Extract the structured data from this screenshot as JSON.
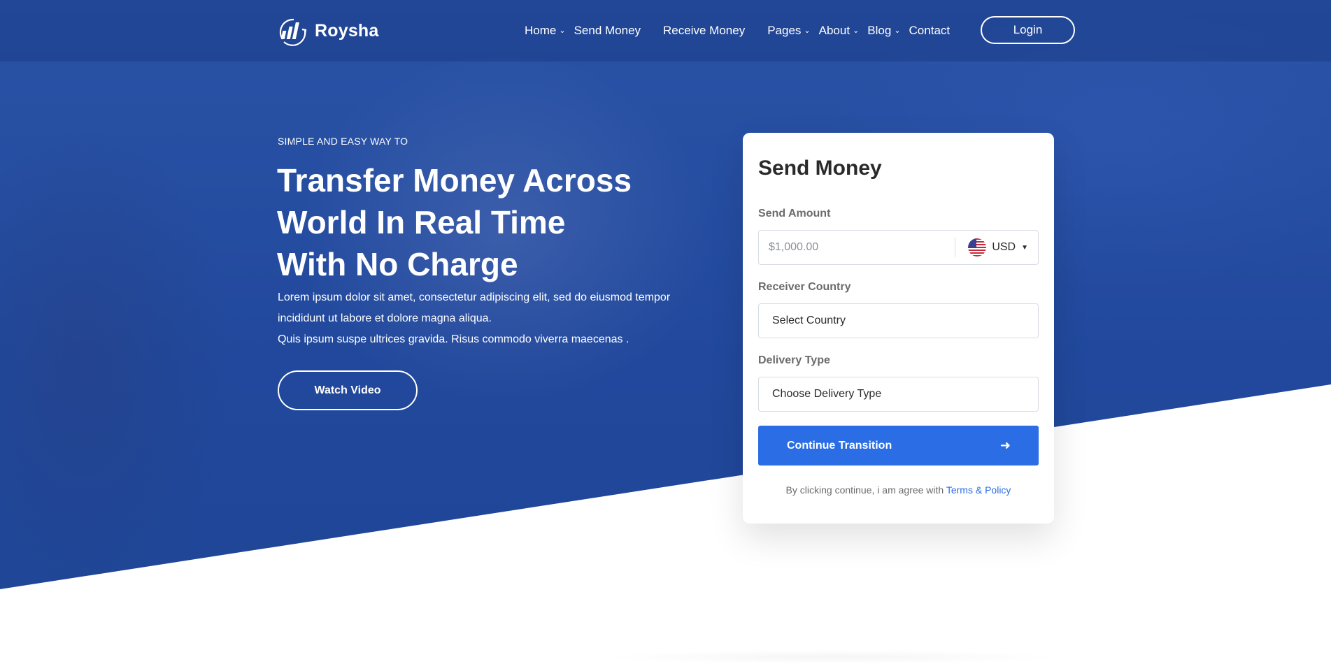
{
  "brand": {
    "name": "Roysha"
  },
  "nav": {
    "items": [
      {
        "label": "Home",
        "dropdown": true
      },
      {
        "label": "Send Money",
        "dropdown": false
      },
      {
        "label": "Receive Money",
        "dropdown": false
      },
      {
        "label": "Pages",
        "dropdown": true
      },
      {
        "label": "About",
        "dropdown": true
      },
      {
        "label": "Blog",
        "dropdown": true
      },
      {
        "label": "Contact",
        "dropdown": false
      }
    ],
    "login_label": "Login"
  },
  "hero": {
    "eyebrow": "SIMPLE AND EASY WAY TO",
    "headline_lines": [
      "Transfer Money Across",
      "World In Real Time",
      "With No Charge"
    ],
    "description_lines": [
      "Lorem ipsum dolor sit amet, consectetur adipiscing elit, sed do eiusmod tempor",
      "incididunt ut labore et dolore magna aliqua.",
      "Quis ipsum suspe ultrices gravida. Risus commodo viverra maecenas ."
    ],
    "watch_video_label": "Watch Video"
  },
  "send_form": {
    "title": "Send Money",
    "amount_label": "Send Amount",
    "amount_placeholder": "$1,000.00",
    "currency": {
      "code": "USD",
      "flag_icon": "us-flag-icon"
    },
    "receiver_label": "Receiver Country",
    "receiver_value": "Select Country",
    "delivery_label": "Delivery Type",
    "delivery_value": "Choose Delivery Type",
    "continue_label": "Continue Transition",
    "terms_text": "By clicking continue, i am agree with",
    "terms_link": "Terms & Policy"
  },
  "colors": {
    "hero_blue": "#21489c",
    "accent": "#2a6de5",
    "text_dark": "#2a2a2a"
  }
}
